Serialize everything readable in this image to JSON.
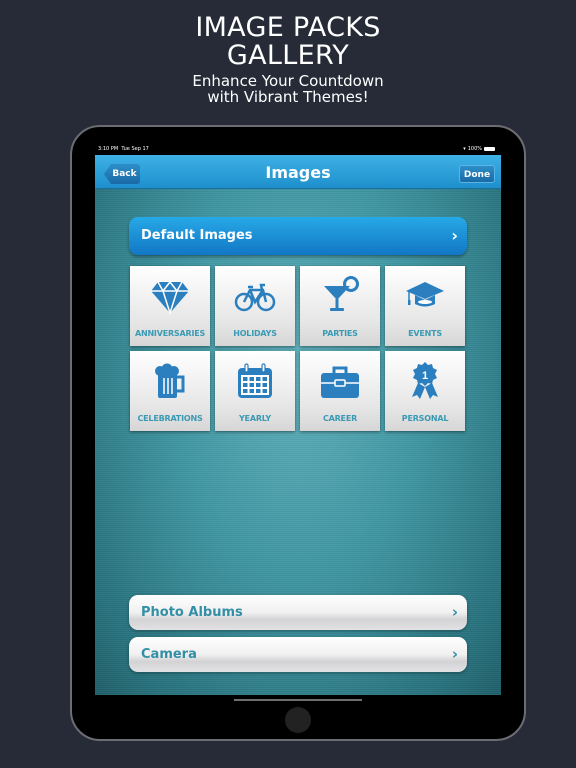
{
  "promo": {
    "title_line1": "IMAGE PACKS",
    "title_line2": "GALLERY",
    "subtitle_line1": "Enhance Your Countdown",
    "subtitle_line2": "with Vibrant Themes!"
  },
  "status_bar": {
    "time": "3:10 PM",
    "date": "Tue Sep 17",
    "battery": "100%",
    "wifi_icon": "wifi-icon",
    "battery_icon": "battery-icon"
  },
  "navbar": {
    "title": "Images",
    "back_label": "Back",
    "done_label": "Done"
  },
  "default_images": {
    "label": "Default Images",
    "chevron": "›"
  },
  "categories": [
    {
      "label": "ANNIVERSARIES",
      "icon": "diamond-icon"
    },
    {
      "label": "HOLIDAYS",
      "icon": "bicycle-icon"
    },
    {
      "label": "PARTIES",
      "icon": "cocktail-icon"
    },
    {
      "label": "EVENTS",
      "icon": "graduation-cap-icon"
    },
    {
      "label": "CELEBRATIONS",
      "icon": "beer-mug-icon"
    },
    {
      "label": "YEARLY",
      "icon": "calendar-icon"
    },
    {
      "label": "CAREER",
      "icon": "briefcase-icon"
    },
    {
      "label": "PERSONAL",
      "icon": "award-ribbon-icon",
      "badge_text": "1"
    }
  ],
  "sources": [
    {
      "label": "Photo Albums",
      "chevron": "›"
    },
    {
      "label": "Camera",
      "chevron": "›"
    }
  ],
  "colors": {
    "accent_blue": "#1e8fcc",
    "icon_blue": "#2b7fbf",
    "label_teal": "#3a9ab4",
    "background": "#262b37"
  }
}
